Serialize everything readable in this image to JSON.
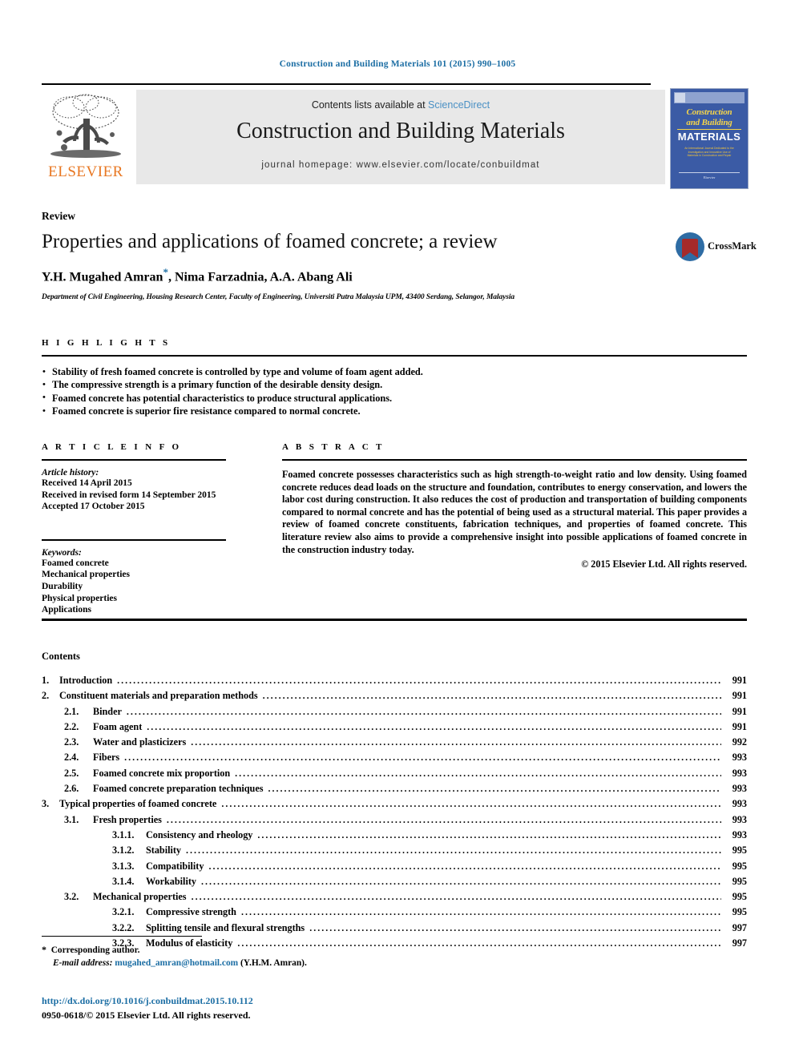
{
  "running_head": "Construction and Building Materials 101 (2015) 990–1005",
  "masthead": {
    "publisher_name": "ELSEVIER",
    "contents_prefix": "Contents lists available at ",
    "sciencedirect": "ScienceDirect",
    "journal_title": "Construction and Building Materials",
    "homepage": "journal homepage: www.elsevier.com/locate/conbuildmat",
    "cover": {
      "line1": "Construction",
      "line2": "and Building",
      "line3": "MATERIALS",
      "subtitle": "An International Journal Dedicated to the Investigation and Innovative Use of Materials in Construction and Repair",
      "footer": "Elsevier"
    }
  },
  "article": {
    "kicker": "Review",
    "title": "Properties and applications of foamed concrete; a review",
    "authors": "Y.H. Mugahed Amran",
    "authors_rest": ", Nima Farzadnia, A.A. Abang Ali",
    "corresponding_marker": "*",
    "affiliation": "Department of Civil Engineering, Housing Research Center, Faculty of Engineering, Universiti Putra Malaysia UPM, 43400 Serdang, Selangor, Malaysia",
    "crossmark_label": "CrossMark"
  },
  "highlights": {
    "heading": "H I G H L I G H T S",
    "items": [
      "Stability of fresh foamed concrete is controlled by type and volume of foam agent added.",
      "The compressive strength is a primary function of the desirable density design.",
      "Foamed concrete has potential characteristics to produce structural applications.",
      "Foamed concrete is superior fire resistance compared to normal concrete."
    ]
  },
  "article_info": {
    "heading": "A R T I C L E   I N F O",
    "history_label": "Article history:",
    "history": [
      "Received 14 April 2015",
      "Received in revised form 14 September 2015",
      "Accepted 17 October 2015"
    ],
    "keywords_label": "Keywords:",
    "keywords": [
      "Foamed concrete",
      "Mechanical properties",
      "Durability",
      "Physical properties",
      "Applications"
    ]
  },
  "abstract": {
    "heading": "A B S T R A C T",
    "text": "Foamed concrete possesses characteristics such as high strength-to-weight ratio and low density. Using foamed concrete reduces dead loads on the structure and foundation, contributes to energy conservation, and lowers the labor cost during construction. It also reduces the cost of production and transportation of building components compared to normal concrete and has the potential of being used as a structural material. This paper provides a review of foamed concrete constituents, fabrication techniques, and properties of foamed concrete. This literature review also aims to provide a comprehensive insight into possible applications of foamed concrete in the construction industry today.",
    "copyright": "© 2015 Elsevier Ltd. All rights reserved."
  },
  "contents": {
    "heading": "Contents",
    "entries": [
      {
        "level": 1,
        "num": "1.",
        "label": "Introduction",
        "page": "991"
      },
      {
        "level": 1,
        "num": "2.",
        "label": "Constituent materials and preparation methods",
        "page": "991"
      },
      {
        "level": 2,
        "num": "2.1.",
        "label": "Binder",
        "page": "991"
      },
      {
        "level": 2,
        "num": "2.2.",
        "label": "Foam agent",
        "page": "991"
      },
      {
        "level": 2,
        "num": "2.3.",
        "label": "Water and plasticizers",
        "page": "992"
      },
      {
        "level": 2,
        "num": "2.4.",
        "label": "Fibers",
        "page": "993"
      },
      {
        "level": 2,
        "num": "2.5.",
        "label": "Foamed concrete mix proportion",
        "page": "993"
      },
      {
        "level": 2,
        "num": "2.6.",
        "label": "Foamed concrete preparation techniques",
        "page": "993"
      },
      {
        "level": 1,
        "num": "3.",
        "label": "Typical properties of foamed concrete",
        "page": "993"
      },
      {
        "level": 2,
        "num": "3.1.",
        "label": "Fresh properties",
        "page": "993"
      },
      {
        "level": 3,
        "num": "3.1.1.",
        "label": "Consistency and rheology",
        "page": "993"
      },
      {
        "level": 3,
        "num": "3.1.2.",
        "label": "Stability",
        "page": "995"
      },
      {
        "level": 3,
        "num": "3.1.3.",
        "label": "Compatibility",
        "page": "995"
      },
      {
        "level": 3,
        "num": "3.1.4.",
        "label": "Workability",
        "page": "995"
      },
      {
        "level": 2,
        "num": "3.2.",
        "label": "Mechanical properties",
        "page": "995"
      },
      {
        "level": 3,
        "num": "3.2.1.",
        "label": "Compressive strength",
        "page": "995"
      },
      {
        "level": 3,
        "num": "3.2.2.",
        "label": "Splitting tensile and flexural strengths",
        "page": "997"
      },
      {
        "level": 3,
        "num": "3.2.3.",
        "label": "Modulus of elasticity",
        "page": "997"
      }
    ]
  },
  "footnotes": {
    "corresponding": "Corresponding author.",
    "email_label": "E-mail address:",
    "email": "mugahed_amran@hotmail.com",
    "email_owner": "(Y.H.M. Amran).",
    "doi": "http://dx.doi.org/10.1016/j.conbuildmat.2015.10.112",
    "issn": "0950-0618/© 2015 Elsevier Ltd. All rights reserved."
  }
}
